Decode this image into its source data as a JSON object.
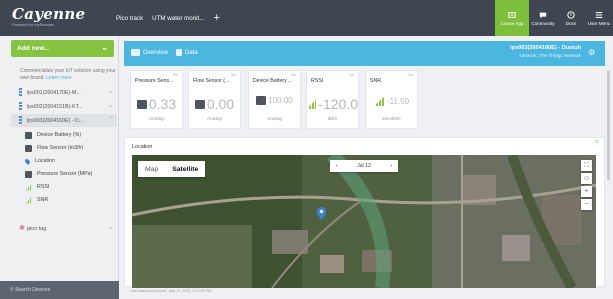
{
  "app": {
    "logo": "Cayenne",
    "tagline": "Powered by myDevices"
  },
  "tabs": [
    "Pico track",
    "UTM water monit...",
    "+"
  ],
  "top_right": [
    {
      "label": "Create App",
      "icon": "create-app-icon"
    },
    {
      "label": "Community",
      "icon": "chat-icon"
    },
    {
      "label": "Docs",
      "icon": "docs-icon"
    },
    {
      "label": "User Menu",
      "icon": "user-menu-icon"
    }
  ],
  "sidebar": {
    "add_new": "Add new...",
    "promo": "Commercialize your IoT solution using your own brand.",
    "promo_link": "Learn more",
    "devices": [
      {
        "name": "lps001(2604170E)-M..."
      },
      {
        "name": "lps002(2604151B)-KT..."
      },
      {
        "name": "lps003(2604160E) - D..."
      }
    ],
    "channels": [
      {
        "label": "Device Battery (%)",
        "icon": "gauge-icon"
      },
      {
        "label": "Flow Sensor (m3/h)",
        "icon": "gauge-icon"
      },
      {
        "label": "Location",
        "icon": "location-icon"
      },
      {
        "label": "Pressure Sensor (MPa)",
        "icon": "gauge-icon"
      },
      {
        "label": "RSSI",
        "icon": "signal-icon"
      },
      {
        "label": "SNR",
        "icon": "signal-icon"
      }
    ],
    "pico_tag": "pico tag",
    "search_placeholder": "Search Devices"
  },
  "header": {
    "overview_label": "Overview",
    "data_label": "Data",
    "device_title": "lps003(2604160E) - Dustuh",
    "network": "Network: The Things Network"
  },
  "widgets": [
    {
      "title": "Pressure Sens...",
      "channel": "3m",
      "value": "0.33",
      "unit": "Analog",
      "icon": "gauge"
    },
    {
      "title": "Flow Sensor (...",
      "channel": "3m",
      "value": "0.00",
      "unit": "Analog",
      "icon": "gauge"
    },
    {
      "title": "Device Battery ...",
      "channel": "3m",
      "value": "100.00",
      "unit": "Analog",
      "icon": "gauge"
    },
    {
      "title": "RSSI",
      "channel": "3m",
      "value": "-120.0",
      "unit": "dBm",
      "icon": "signal"
    },
    {
      "title": "SNR",
      "channel": "3m",
      "value": "-11.50",
      "unit": "Decibels",
      "icon": "signal"
    }
  ],
  "location": {
    "title": "Location",
    "map_type": [
      "Map",
      "Satellite"
    ],
    "selected_map_type": "Satellite",
    "date": "Jul 12",
    "prev": "‹",
    "next": "›"
  },
  "footer_note": "Last data packet sent: July 12, 2021 3:21:26 PM",
  "colors": {
    "topbar": "#3d4651",
    "accent_green": "#84c441",
    "header_blue": "#4bb6e0",
    "sidebar_bg": "#eef0f2"
  }
}
